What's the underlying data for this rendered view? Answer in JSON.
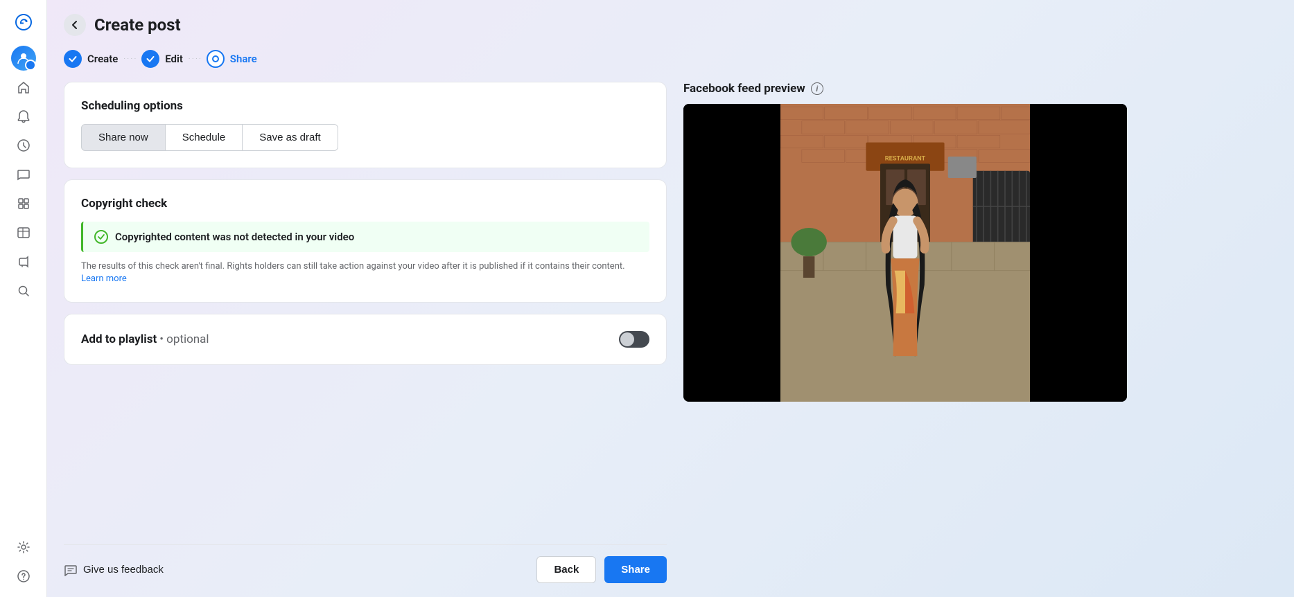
{
  "header": {
    "title": "Create post",
    "back_label": "←"
  },
  "stepper": {
    "steps": [
      {
        "label": "Create",
        "state": "done"
      },
      {
        "label": "Edit",
        "state": "done"
      },
      {
        "label": "Share",
        "state": "active"
      }
    ]
  },
  "scheduling": {
    "section_title": "Scheduling options",
    "buttons": [
      {
        "label": "Share now",
        "active": true
      },
      {
        "label": "Schedule",
        "active": false
      },
      {
        "label": "Save as draft",
        "active": false
      }
    ]
  },
  "copyright": {
    "section_title": "Copyright check",
    "success_message": "Copyrighted content was not detected in your video",
    "note": "The results of this check aren't final. Rights holders can still take action against your video after it is published if it contains their content.",
    "learn_more": "Learn more"
  },
  "playlist": {
    "label": "Add to playlist",
    "optional_text": "• optional",
    "toggle_state": "off"
  },
  "preview": {
    "title": "Facebook feed preview",
    "info_tooltip": "i"
  },
  "footer": {
    "feedback_label": "Give us feedback",
    "back_button": "Back",
    "share_button": "Share"
  },
  "icons": {
    "meta_logo": "M",
    "home": "⌂",
    "bell": "🔔",
    "circle_arrow": "↑",
    "chat": "💬",
    "grid": "▦",
    "table": "⊞",
    "megaphone": "📢",
    "search": "🔍",
    "gear": "⚙",
    "question": "?",
    "back_arrow": "←",
    "checkmark": "✓",
    "info": "i",
    "feedback_chat": "💬"
  }
}
